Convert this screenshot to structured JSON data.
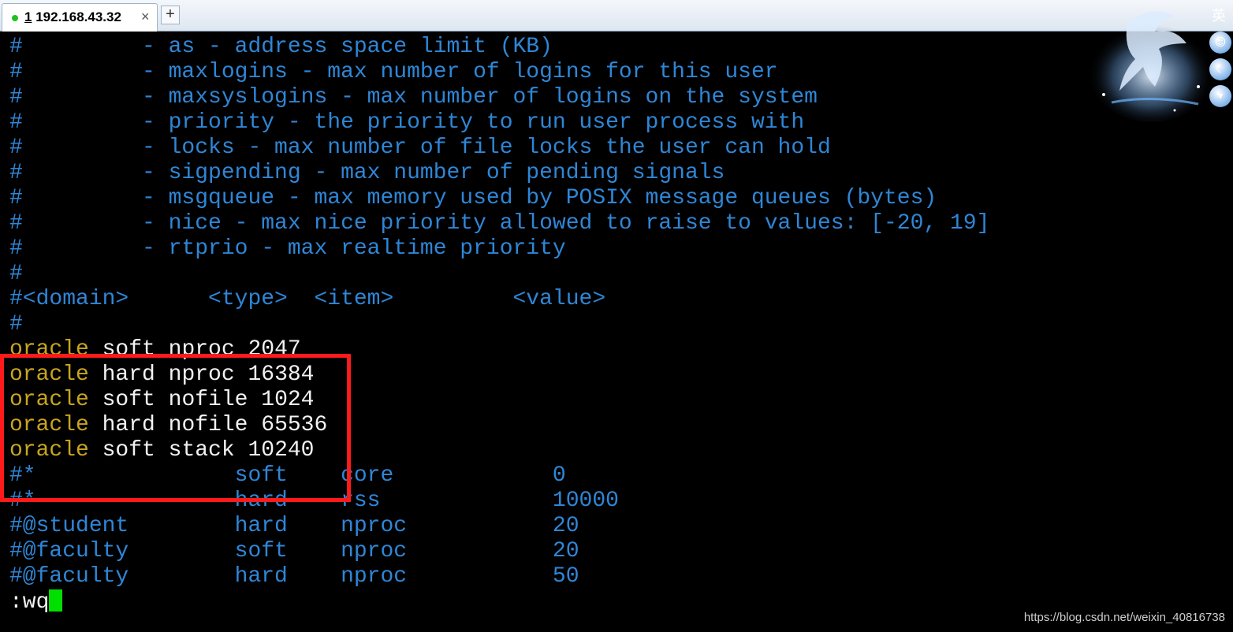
{
  "tab": {
    "index": "1",
    "host": "192.168.43.32",
    "close_glyph": "×",
    "new_tab_glyph": "+"
  },
  "terminal_lines": [
    {
      "segments": [
        {
          "t": "#         - as - address space limit (KB)",
          "c": "blue"
        }
      ]
    },
    {
      "segments": [
        {
          "t": "#         - maxlogins - max number of logins for this user",
          "c": "blue"
        }
      ]
    },
    {
      "segments": [
        {
          "t": "#         - maxsyslogins - max number of logins on the system",
          "c": "blue"
        }
      ]
    },
    {
      "segments": [
        {
          "t": "#         - priority - the priority to run user process with",
          "c": "blue"
        }
      ]
    },
    {
      "segments": [
        {
          "t": "#         - locks - max number of file locks the user can hold",
          "c": "blue"
        }
      ]
    },
    {
      "segments": [
        {
          "t": "#         - sigpending - max number of pending signals",
          "c": "blue"
        }
      ]
    },
    {
      "segments": [
        {
          "t": "#         - msgqueue - max memory used by POSIX message queues (bytes)",
          "c": "blue"
        }
      ]
    },
    {
      "segments": [
        {
          "t": "#         - nice - max nice priority allowed to raise to values: [-20, 19]",
          "c": "blue"
        }
      ]
    },
    {
      "segments": [
        {
          "t": "#         - rtprio - max realtime priority",
          "c": "blue"
        }
      ]
    },
    {
      "segments": [
        {
          "t": "#",
          "c": "blue"
        }
      ]
    },
    {
      "segments": [
        {
          "t": "#<domain>      <type>  <item>         <value>",
          "c": "blue"
        }
      ]
    },
    {
      "segments": [
        {
          "t": "#",
          "c": "blue"
        }
      ]
    },
    {
      "segments": [
        {
          "t": "oracle",
          "c": "yellow"
        },
        {
          "t": " soft nproc 2047",
          "c": "white"
        }
      ]
    },
    {
      "segments": [
        {
          "t": "oracle",
          "c": "yellow"
        },
        {
          "t": " hard nproc 16384",
          "c": "white"
        }
      ]
    },
    {
      "segments": [
        {
          "t": "oracle",
          "c": "yellow"
        },
        {
          "t": " soft nofile 1024",
          "c": "white"
        }
      ]
    },
    {
      "segments": [
        {
          "t": "oracle",
          "c": "yellow"
        },
        {
          "t": " hard nofile 65536",
          "c": "white"
        }
      ]
    },
    {
      "segments": [
        {
          "t": "oracle",
          "c": "yellow"
        },
        {
          "t": " soft stack 10240",
          "c": "white"
        }
      ]
    },
    {
      "segments": [
        {
          "t": "#*               soft    core            0",
          "c": "blue"
        }
      ]
    },
    {
      "segments": [
        {
          "t": "#*               hard    rss             10000",
          "c": "blue"
        }
      ]
    },
    {
      "segments": [
        {
          "t": "#@student        hard    nproc           20",
          "c": "blue"
        }
      ]
    },
    {
      "segments": [
        {
          "t": "#@faculty        soft    nproc           20",
          "c": "blue"
        }
      ]
    },
    {
      "segments": [
        {
          "t": "#@faculty        hard    nproc           50",
          "c": "blue"
        }
      ]
    }
  ],
  "command_line": ":wq",
  "ime_indicator": "英",
  "side_buttons": [
    "☺",
    "☾",
    "▾"
  ],
  "watermark": "https://blog.csdn.net/weixin_40816738",
  "colors": {
    "comment": "#2f86d6",
    "user": "#c8a51e",
    "text": "#f2f2f2",
    "cursor": "#00e000",
    "highlight": "#ff1a1a"
  }
}
